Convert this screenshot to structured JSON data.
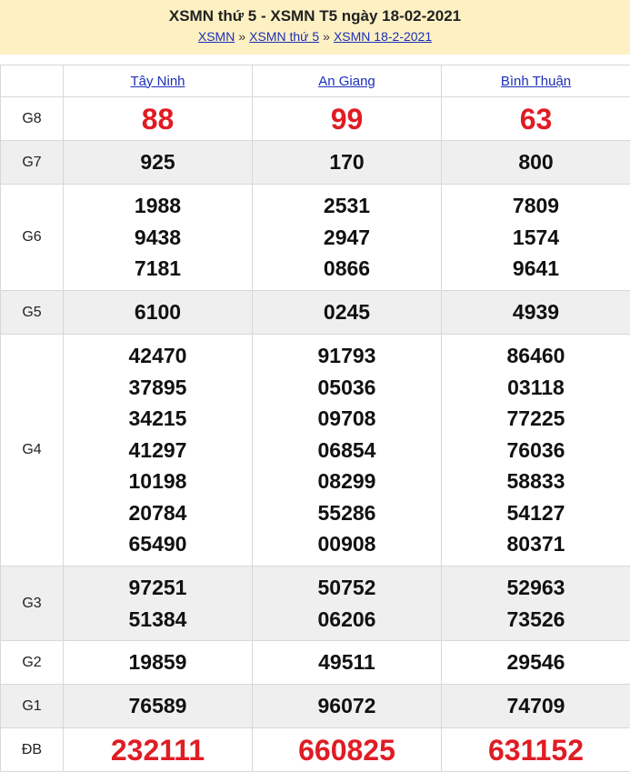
{
  "header": {
    "title": "XSMN thứ 5 - XSMN T5 ngày 18-02-2021",
    "breadcrumb": [
      "XSMN",
      "XSMN thứ 5",
      "XSMN 18-2-2021"
    ],
    "separator": "»"
  },
  "provinces": [
    "Tây Ninh",
    "An Giang",
    "Bình Thuận"
  ],
  "rows": [
    {
      "label": "G8",
      "shade": false,
      "style": "big",
      "values": [
        [
          "88"
        ],
        [
          "99"
        ],
        [
          "63"
        ]
      ]
    },
    {
      "label": "G7",
      "shade": true,
      "style": "num",
      "values": [
        [
          "925"
        ],
        [
          "170"
        ],
        [
          "800"
        ]
      ]
    },
    {
      "label": "G6",
      "shade": false,
      "style": "num",
      "values": [
        [
          "1988",
          "9438",
          "7181"
        ],
        [
          "2531",
          "2947",
          "0866"
        ],
        [
          "7809",
          "1574",
          "9641"
        ]
      ]
    },
    {
      "label": "G5",
      "shade": true,
      "style": "num",
      "values": [
        [
          "6100"
        ],
        [
          "0245"
        ],
        [
          "4939"
        ]
      ]
    },
    {
      "label": "G4",
      "shade": false,
      "style": "num",
      "values": [
        [
          "42470",
          "37895",
          "34215",
          "41297",
          "10198",
          "20784",
          "65490"
        ],
        [
          "91793",
          "05036",
          "09708",
          "06854",
          "08299",
          "55286",
          "00908"
        ],
        [
          "86460",
          "03118",
          "77225",
          "76036",
          "58833",
          "54127",
          "80371"
        ]
      ]
    },
    {
      "label": "G3",
      "shade": true,
      "style": "num",
      "values": [
        [
          "97251",
          "51384"
        ],
        [
          "50752",
          "06206"
        ],
        [
          "52963",
          "73526"
        ]
      ]
    },
    {
      "label": "G2",
      "shade": false,
      "style": "num",
      "values": [
        [
          "19859"
        ],
        [
          "49511"
        ],
        [
          "29546"
        ]
      ]
    },
    {
      "label": "G1",
      "shade": true,
      "style": "num",
      "values": [
        [
          "76589"
        ],
        [
          "96072"
        ],
        [
          "74709"
        ]
      ]
    },
    {
      "label": "ĐB",
      "shade": false,
      "style": "db",
      "values": [
        [
          "232111"
        ],
        [
          "660825"
        ],
        [
          "631152"
        ]
      ]
    }
  ]
}
